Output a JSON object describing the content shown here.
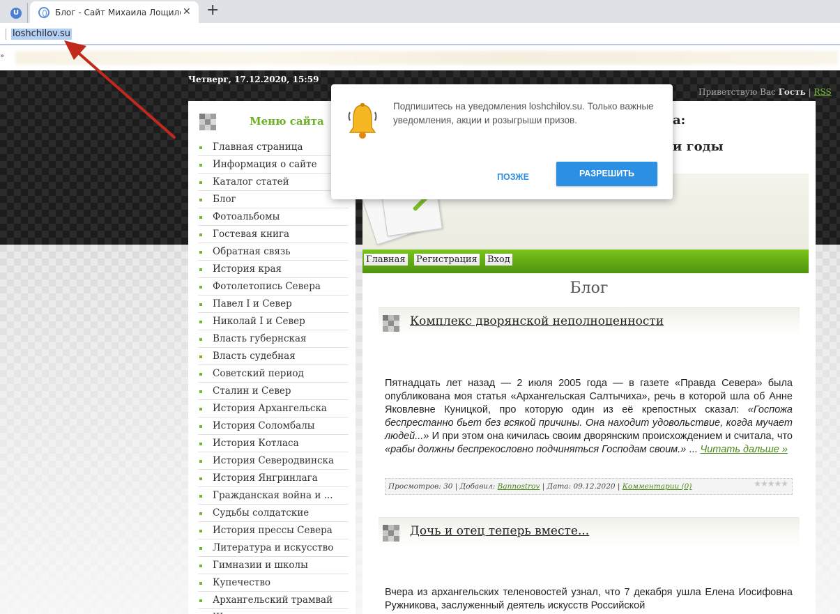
{
  "browser": {
    "inactive_tab_icon": "U",
    "active_tab_title": "Блог - Сайт Михаила Лощилова",
    "tab_close": "✕",
    "new_tab": "+",
    "url": "loshchilov.su",
    "bookmarks_overflow": "»"
  },
  "site": {
    "datetime": "Четверг, 17.12.2020, 15:59",
    "greeting_prefix": "Приветствую Вас",
    "greeting_user": "Гость",
    "greeting_sep": "|",
    "rss": "RSS",
    "title_line1": "а:",
    "title_line2": "и годы",
    "sidebar": {
      "title": "Меню сайта",
      "items": [
        "Главная страница",
        "Информация о сайте",
        "Каталог статей",
        "Блог",
        "Фотоальбомы",
        "Гостевая книга",
        "Обратная связь",
        "История края",
        "Фотолетопись Севера",
        "Павел I и Север",
        "Николай I и Север",
        "Власть губернская",
        "Власть судебная",
        "Советский период",
        "Сталин и Север",
        "История Архангельска",
        "История Соломбалы",
        "История Котласа",
        "История Северодвинска",
        "История Янгринлага",
        "Гражданская война и ...",
        "Судьбы солдатские",
        "История прессы Севера",
        "Литература и искусство",
        "Гимназии и школы",
        "Купечество",
        "Архангельский трамвай",
        "Ж..."
      ]
    },
    "nav": {
      "home": "Главная",
      "register": "Регистрация",
      "login": "Вход"
    },
    "page_heading": "Блог",
    "posts": [
      {
        "title": "Комплекс дворянской неполноценности",
        "body_plain1": "Пятнадцать лет назад — 2 июля 2005 года — в газете «Правда Севера» была опубликована моя статья «Архангельская Салтычиха», речь в которой шла об Анне Яковлевне Куницкой, про которую один из её крепостных сказал: ",
        "body_italic1": "«Госпожа беспрестанно бьет без всякой причины. Она находит удовольствие, когда мучает людей...»",
        "body_plain2": " И при этом она кичилась своим дворянским происхождением и считала, что ",
        "body_italic2": "«рабы должны беспрекословно подчиняться Господам своим.»",
        "body_plain3": " ... ",
        "read_more": "Читать дальше »",
        "meta_views": "Просмотров: 30 | Добавил: ",
        "meta_author": "Bannostrov",
        "meta_date": " | Дата: 09.12.2020 | ",
        "meta_comments": "Комментарии (0)",
        "rating": 0
      },
      {
        "title": "Дочь и отец теперь вместе...",
        "body_plain1": "Вчера из архангельских теленовостей узнал, что 7 декабря ушла Елена Иосифовна Ружникова, заслуженный деятель искусств Российской"
      }
    ]
  },
  "popup": {
    "message": "Подпишитесь на уведомления loshchilov.su. Только важные уведомления, акции и розыгрыши призов.",
    "later": "ПОЗЖЕ",
    "allow": "РАЗРЕШИТЬ"
  },
  "colors": {
    "accent_green": "#6bb222",
    "allow_blue": "#2b8fe3",
    "arrow_red": "#c0291b"
  }
}
